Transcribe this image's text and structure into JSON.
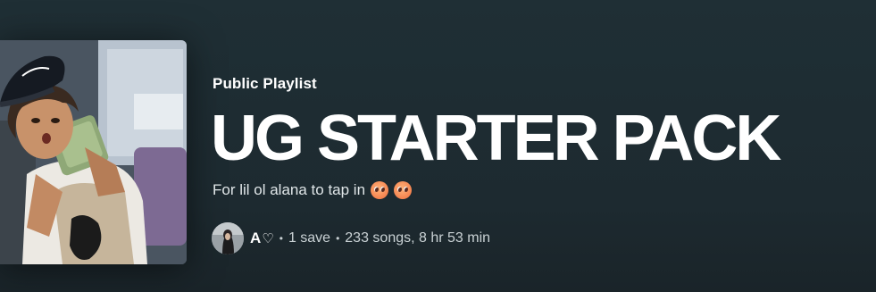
{
  "playlist": {
    "type_label": "Public Playlist",
    "title": "UG STARTER PACK",
    "description": "For lil ol alana to tap in",
    "description_emojis": [
      "pleading-face-emoji",
      "pleading-face-emoji"
    ],
    "owner_name": "A",
    "owner_icon": "heart-outline-icon",
    "saves": "1 save",
    "stats": "233 songs, 8 hr 53 min"
  },
  "colors": {
    "background": "#1f2f35",
    "text_primary": "#ffffff",
    "text_secondary": "#c9d1d4"
  }
}
